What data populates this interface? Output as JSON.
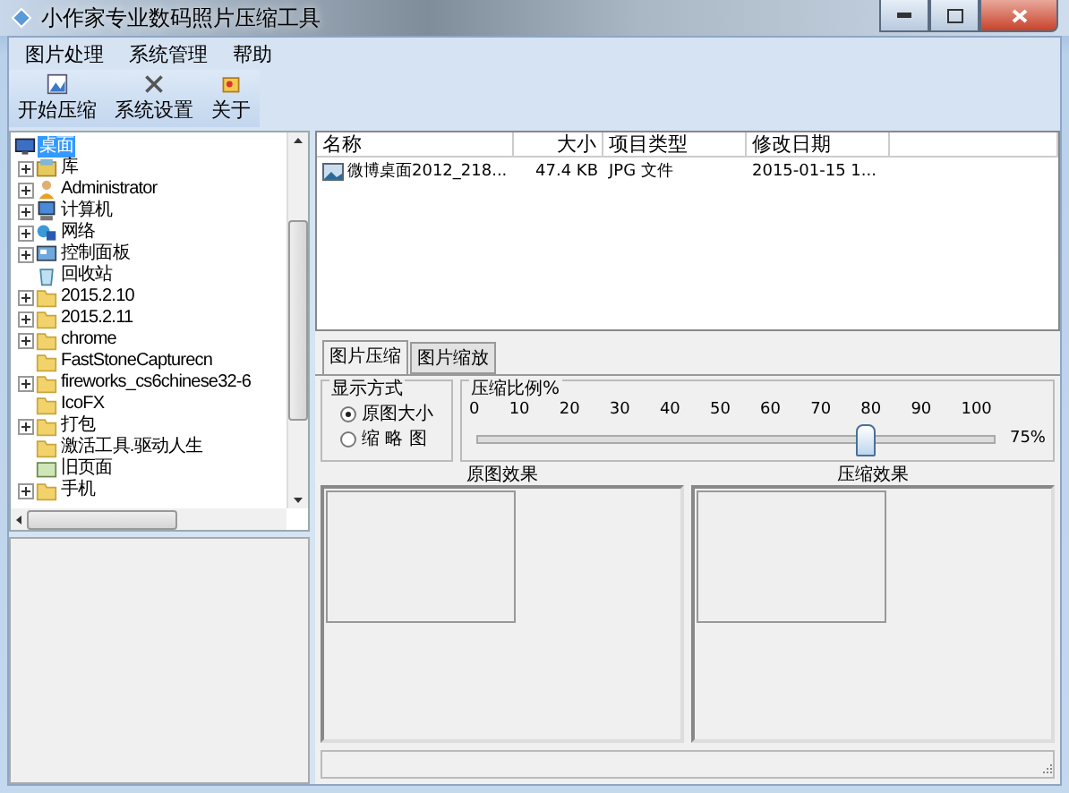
{
  "window": {
    "title": "小作家专业数码照片压缩工具"
  },
  "menu": [
    "图片处理",
    "系统管理",
    "帮助"
  ],
  "toolbar": [
    "开始压缩",
    "系统设置",
    "关于"
  ],
  "tree": {
    "label": "桌面",
    "selected": true,
    "children": [
      {
        "label": "库",
        "kind": "library",
        "expandable": true
      },
      {
        "label": "Administrator",
        "kind": "user",
        "expandable": true
      },
      {
        "label": "计算机",
        "kind": "computer",
        "expandable": true
      },
      {
        "label": "网络",
        "kind": "network",
        "expandable": true
      },
      {
        "label": "控制面板",
        "kind": "panel",
        "expandable": true
      },
      {
        "label": "回收站",
        "kind": "recycle",
        "expandable": false
      },
      {
        "label": "2015.2.10",
        "kind": "folder",
        "expandable": true
      },
      {
        "label": "2015.2.11",
        "kind": "folder",
        "expandable": true
      },
      {
        "label": "chrome",
        "kind": "folder",
        "expandable": true
      },
      {
        "label": "FastStoneCapturecn",
        "kind": "folder",
        "expandable": false
      },
      {
        "label": "fireworks_cs6chinese32-6",
        "kind": "folder",
        "expandable": true
      },
      {
        "label": "IcoFX",
        "kind": "folder",
        "expandable": false
      },
      {
        "label": "打包",
        "kind": "folder",
        "expandable": true
      },
      {
        "label": "激活工具.驱动人生",
        "kind": "folder",
        "expandable": false
      },
      {
        "label": "旧页面",
        "kind": "page",
        "expandable": false
      },
      {
        "label": "手机",
        "kind": "folder",
        "expandable": true
      }
    ]
  },
  "file_list": {
    "columns": [
      "名称",
      "大小",
      "项目类型",
      "修改日期"
    ],
    "rows": [
      {
        "name": "微博桌面2012_218...",
        "size": "47.4 KB",
        "type": "JPG 文件",
        "date": "2015-01-15 1..."
      }
    ]
  },
  "tabs": [
    {
      "label": "图片压缩",
      "selected": true
    },
    {
      "label": "图片缩放",
      "selected": false
    }
  ],
  "display_mode": {
    "title": "显示方式",
    "options": [
      {
        "label": "原图大小",
        "selected": true
      },
      {
        "label": "缩 略 图",
        "selected": false
      }
    ]
  },
  "compression": {
    "title": "压缩比例%",
    "ticks": [
      "0",
      "10",
      "20",
      "30",
      "40",
      "50",
      "60",
      "70",
      "80",
      "90",
      "100"
    ],
    "level": 0.75,
    "reading": "75%"
  },
  "previews": [
    "原图效果",
    "压缩效果"
  ]
}
